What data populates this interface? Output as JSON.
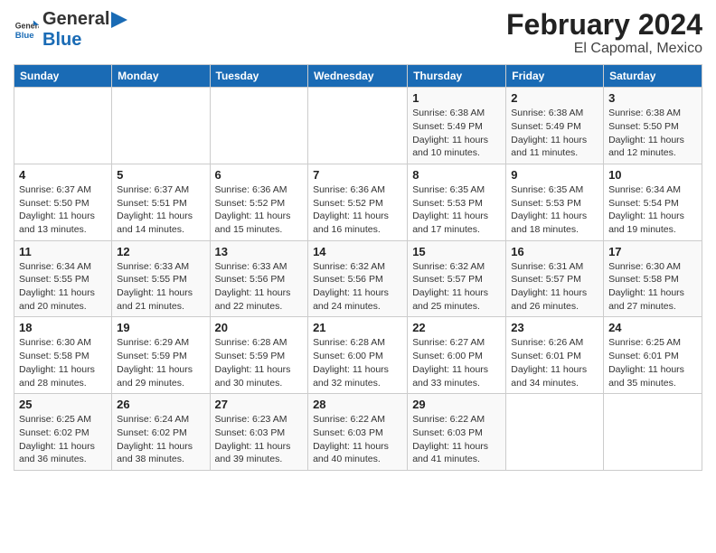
{
  "header": {
    "logo_general": "General",
    "logo_blue": "Blue",
    "month": "February 2024",
    "location": "El Capomal, Mexico"
  },
  "days_of_week": [
    "Sunday",
    "Monday",
    "Tuesday",
    "Wednesday",
    "Thursday",
    "Friday",
    "Saturday"
  ],
  "weeks": [
    [
      {
        "day": "",
        "info": ""
      },
      {
        "day": "",
        "info": ""
      },
      {
        "day": "",
        "info": ""
      },
      {
        "day": "",
        "info": ""
      },
      {
        "day": "1",
        "info": "Sunrise: 6:38 AM\nSunset: 5:49 PM\nDaylight: 11 hours and 10 minutes."
      },
      {
        "day": "2",
        "info": "Sunrise: 6:38 AM\nSunset: 5:49 PM\nDaylight: 11 hours and 11 minutes."
      },
      {
        "day": "3",
        "info": "Sunrise: 6:38 AM\nSunset: 5:50 PM\nDaylight: 11 hours and 12 minutes."
      }
    ],
    [
      {
        "day": "4",
        "info": "Sunrise: 6:37 AM\nSunset: 5:50 PM\nDaylight: 11 hours and 13 minutes."
      },
      {
        "day": "5",
        "info": "Sunrise: 6:37 AM\nSunset: 5:51 PM\nDaylight: 11 hours and 14 minutes."
      },
      {
        "day": "6",
        "info": "Sunrise: 6:36 AM\nSunset: 5:52 PM\nDaylight: 11 hours and 15 minutes."
      },
      {
        "day": "7",
        "info": "Sunrise: 6:36 AM\nSunset: 5:52 PM\nDaylight: 11 hours and 16 minutes."
      },
      {
        "day": "8",
        "info": "Sunrise: 6:35 AM\nSunset: 5:53 PM\nDaylight: 11 hours and 17 minutes."
      },
      {
        "day": "9",
        "info": "Sunrise: 6:35 AM\nSunset: 5:53 PM\nDaylight: 11 hours and 18 minutes."
      },
      {
        "day": "10",
        "info": "Sunrise: 6:34 AM\nSunset: 5:54 PM\nDaylight: 11 hours and 19 minutes."
      }
    ],
    [
      {
        "day": "11",
        "info": "Sunrise: 6:34 AM\nSunset: 5:55 PM\nDaylight: 11 hours and 20 minutes."
      },
      {
        "day": "12",
        "info": "Sunrise: 6:33 AM\nSunset: 5:55 PM\nDaylight: 11 hours and 21 minutes."
      },
      {
        "day": "13",
        "info": "Sunrise: 6:33 AM\nSunset: 5:56 PM\nDaylight: 11 hours and 22 minutes."
      },
      {
        "day": "14",
        "info": "Sunrise: 6:32 AM\nSunset: 5:56 PM\nDaylight: 11 hours and 24 minutes."
      },
      {
        "day": "15",
        "info": "Sunrise: 6:32 AM\nSunset: 5:57 PM\nDaylight: 11 hours and 25 minutes."
      },
      {
        "day": "16",
        "info": "Sunrise: 6:31 AM\nSunset: 5:57 PM\nDaylight: 11 hours and 26 minutes."
      },
      {
        "day": "17",
        "info": "Sunrise: 6:30 AM\nSunset: 5:58 PM\nDaylight: 11 hours and 27 minutes."
      }
    ],
    [
      {
        "day": "18",
        "info": "Sunrise: 6:30 AM\nSunset: 5:58 PM\nDaylight: 11 hours and 28 minutes."
      },
      {
        "day": "19",
        "info": "Sunrise: 6:29 AM\nSunset: 5:59 PM\nDaylight: 11 hours and 29 minutes."
      },
      {
        "day": "20",
        "info": "Sunrise: 6:28 AM\nSunset: 5:59 PM\nDaylight: 11 hours and 30 minutes."
      },
      {
        "day": "21",
        "info": "Sunrise: 6:28 AM\nSunset: 6:00 PM\nDaylight: 11 hours and 32 minutes."
      },
      {
        "day": "22",
        "info": "Sunrise: 6:27 AM\nSunset: 6:00 PM\nDaylight: 11 hours and 33 minutes."
      },
      {
        "day": "23",
        "info": "Sunrise: 6:26 AM\nSunset: 6:01 PM\nDaylight: 11 hours and 34 minutes."
      },
      {
        "day": "24",
        "info": "Sunrise: 6:25 AM\nSunset: 6:01 PM\nDaylight: 11 hours and 35 minutes."
      }
    ],
    [
      {
        "day": "25",
        "info": "Sunrise: 6:25 AM\nSunset: 6:02 PM\nDaylight: 11 hours and 36 minutes."
      },
      {
        "day": "26",
        "info": "Sunrise: 6:24 AM\nSunset: 6:02 PM\nDaylight: 11 hours and 38 minutes."
      },
      {
        "day": "27",
        "info": "Sunrise: 6:23 AM\nSunset: 6:03 PM\nDaylight: 11 hours and 39 minutes."
      },
      {
        "day": "28",
        "info": "Sunrise: 6:22 AM\nSunset: 6:03 PM\nDaylight: 11 hours and 40 minutes."
      },
      {
        "day": "29",
        "info": "Sunrise: 6:22 AM\nSunset: 6:03 PM\nDaylight: 11 hours and 41 minutes."
      },
      {
        "day": "",
        "info": ""
      },
      {
        "day": "",
        "info": ""
      }
    ]
  ]
}
